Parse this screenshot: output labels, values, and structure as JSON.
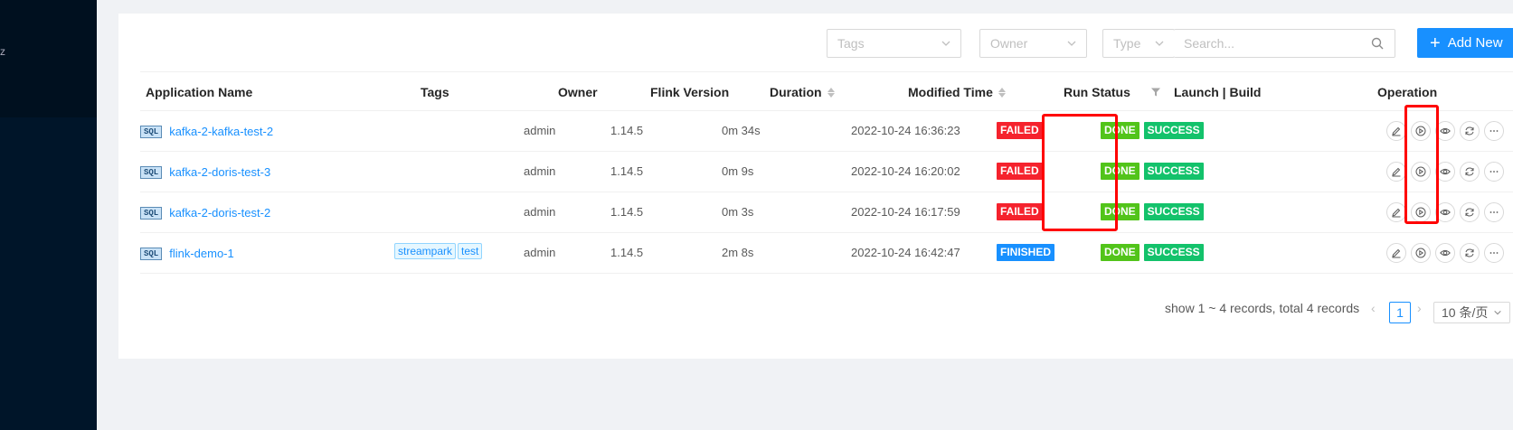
{
  "sidebar": {
    "partial_text": "z"
  },
  "toolbar": {
    "tags_placeholder": "Tags",
    "owner_placeholder": "Owner",
    "type_placeholder": "Type",
    "search_placeholder": "Search...",
    "add_label": "Add New"
  },
  "table": {
    "columns": [
      "Application Name",
      "Tags",
      "Owner",
      "Flink Version",
      "Duration",
      "Modified Time",
      "Run Status",
      "Launch | Build",
      "Operation"
    ],
    "rows": [
      {
        "type_badge": "SQL",
        "name": "kafka-2-kafka-test-2",
        "tags": [],
        "owner": "admin",
        "flink_version": "1.14.5",
        "duration": "0m 34s",
        "modified": "2022-10-24 16:36:23",
        "run_status": "FAILED",
        "launch": "DONE",
        "build": "SUCCESS"
      },
      {
        "type_badge": "SQL",
        "name": "kafka-2-doris-test-3",
        "tags": [],
        "owner": "admin",
        "flink_version": "1.14.5",
        "duration": "0m 9s",
        "modified": "2022-10-24 16:20:02",
        "run_status": "FAILED",
        "launch": "DONE",
        "build": "SUCCESS"
      },
      {
        "type_badge": "SQL",
        "name": "kafka-2-doris-test-2",
        "tags": [],
        "owner": "admin",
        "flink_version": "1.14.5",
        "duration": "0m 3s",
        "modified": "2022-10-24 16:17:59",
        "run_status": "FAILED",
        "launch": "DONE",
        "build": "SUCCESS"
      },
      {
        "type_badge": "SQL",
        "name": "flink-demo-1",
        "tags": [
          "streampark",
          "test"
        ],
        "owner": "admin",
        "flink_version": "1.14.5",
        "duration": "2m 8s",
        "modified": "2022-10-24 16:42:47",
        "run_status": "FINISHED",
        "launch": "DONE",
        "build": "SUCCESS"
      }
    ],
    "operation_icons": [
      "edit-icon",
      "play-icon",
      "eye-icon",
      "sync-icon",
      "more-icon"
    ]
  },
  "pagination": {
    "summary": "show 1 ~ 4 records, total 4 records",
    "current_page": "1",
    "page_size": "10 条/页"
  },
  "colors": {
    "primary": "#1890ff",
    "failed": "#f5222d",
    "done": "#52c41a",
    "success": "#13c26b",
    "highlight_box": "#ff0000",
    "sidebar": "#001529"
  }
}
